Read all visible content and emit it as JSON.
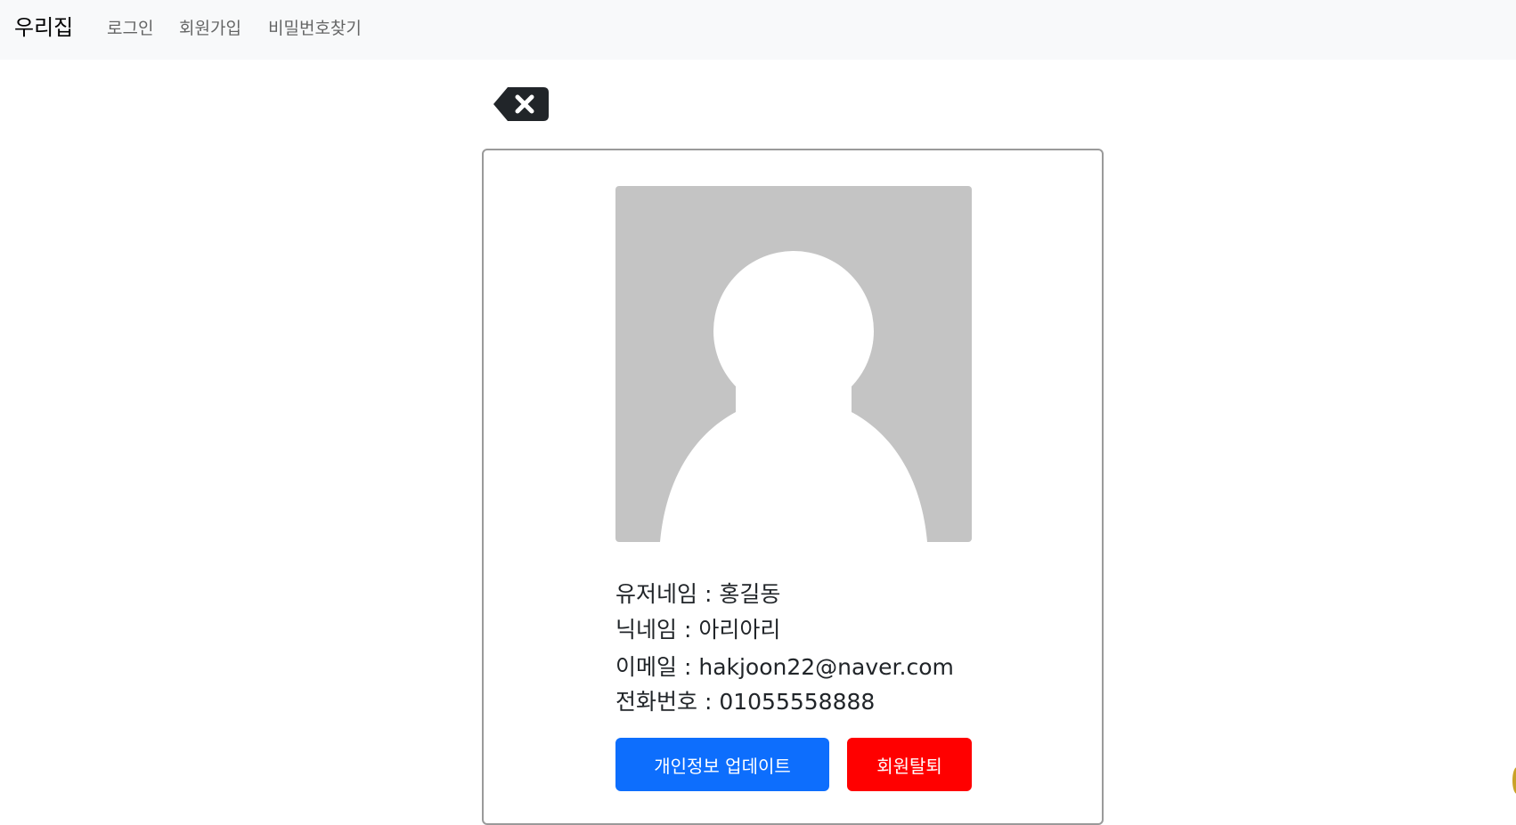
{
  "navbar": {
    "brand": "우리집",
    "links": [
      {
        "label": "로그인"
      },
      {
        "label": "회원가입"
      },
      {
        "label": "비밀번호찾기"
      }
    ]
  },
  "profile": {
    "back_icon": "backspace-x-icon",
    "avatar_icon": "default-user-avatar",
    "fields": [
      {
        "label": "유저네임",
        "value": "홍길동"
      },
      {
        "label": "닉네임",
        "value": "아리아리"
      },
      {
        "label": "이메일",
        "value": "hakjoon22@naver.com"
      },
      {
        "label": "전화번호",
        "value": "01055558888"
      }
    ],
    "separator": " : ",
    "buttons": {
      "update_label": "개인정보 업데이트",
      "delete_label": "회원탈퇴"
    }
  },
  "colors": {
    "primary": "#0d6efd",
    "danger": "#ff0000",
    "navbar_bg": "#f8f9fa",
    "avatar_bg": "#c4c4c4"
  }
}
